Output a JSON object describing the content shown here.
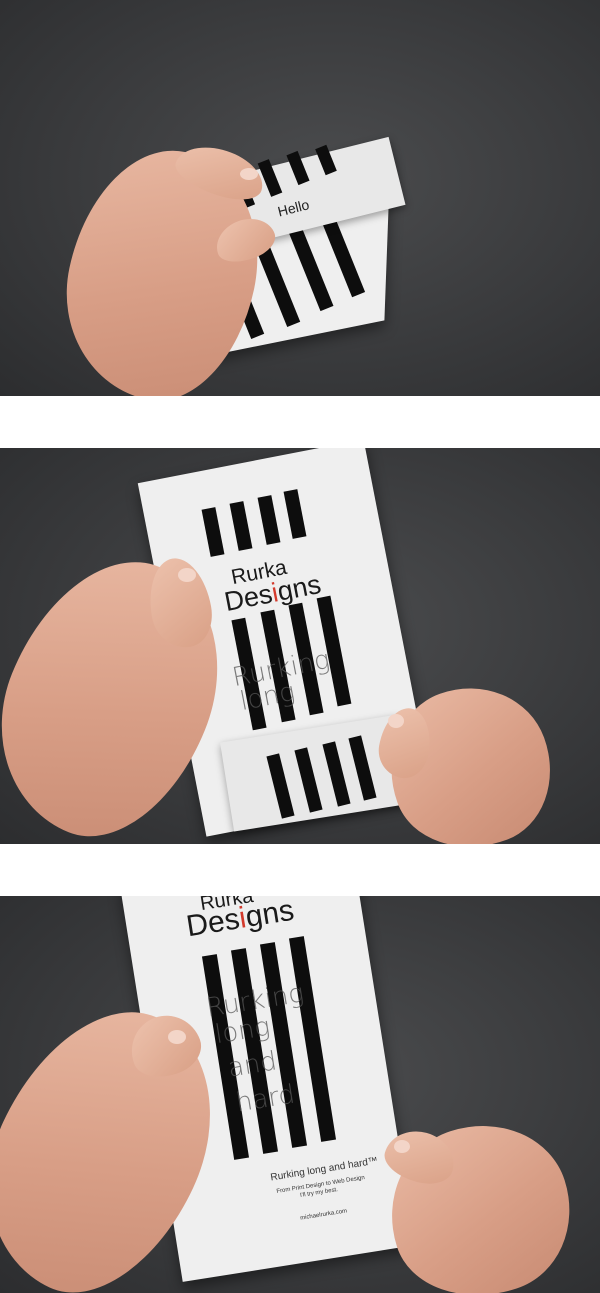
{
  "panel1": {
    "card_text": "Hello"
  },
  "panel2": {
    "logo_line1": "Rurka",
    "logo_line2_a": "Des",
    "logo_line2_i": "i",
    "logo_line2_b": "gns",
    "tagline_line1": "Rurking",
    "tagline_line2": "long"
  },
  "panel3": {
    "logo_line1": "Rurka",
    "logo_line2_a": "Des",
    "logo_line2_i": "i",
    "logo_line2_b": "gns",
    "tagline_line1": "Rurking",
    "tagline_line2": "long",
    "tagline_line3": "and",
    "tagline_line4": "hard",
    "slogan": "Rurking long and hard™",
    "subline1": "From Print Design to Web Design",
    "subline2": "I'll try my best.",
    "url": "michaelrurka.com"
  },
  "colors": {
    "background": "#3a3b3d",
    "paper": "#efefef",
    "bars": "#0d0d0d",
    "logo_accent": "#d33a2c"
  }
}
